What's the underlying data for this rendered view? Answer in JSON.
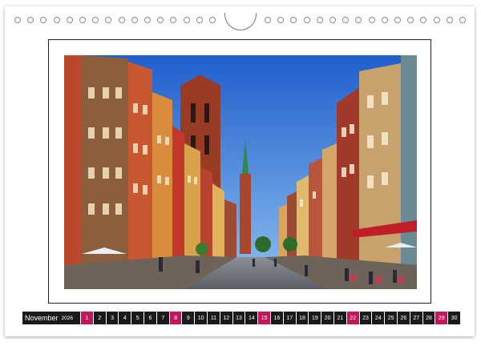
{
  "calendar": {
    "month": "November",
    "year": "2026",
    "days": [
      "1",
      "2",
      "3",
      "4",
      "5",
      "6",
      "7",
      "8",
      "9",
      "10",
      "11",
      "12",
      "13",
      "14",
      "15",
      "16",
      "17",
      "18",
      "19",
      "20",
      "21",
      "22",
      "23",
      "24",
      "25",
      "26",
      "27",
      "28",
      "29",
      "30"
    ],
    "highlighted_days": [
      "1",
      "8",
      "15",
      "22",
      "29"
    ]
  },
  "photo": {
    "subject": "street-scene",
    "colors": {
      "sky": "#2f7be0",
      "brick": "#a63a22",
      "spire": "#2f8a4a"
    }
  },
  "binding": {
    "hole_count_left": 16,
    "hole_count_right": 16
  }
}
